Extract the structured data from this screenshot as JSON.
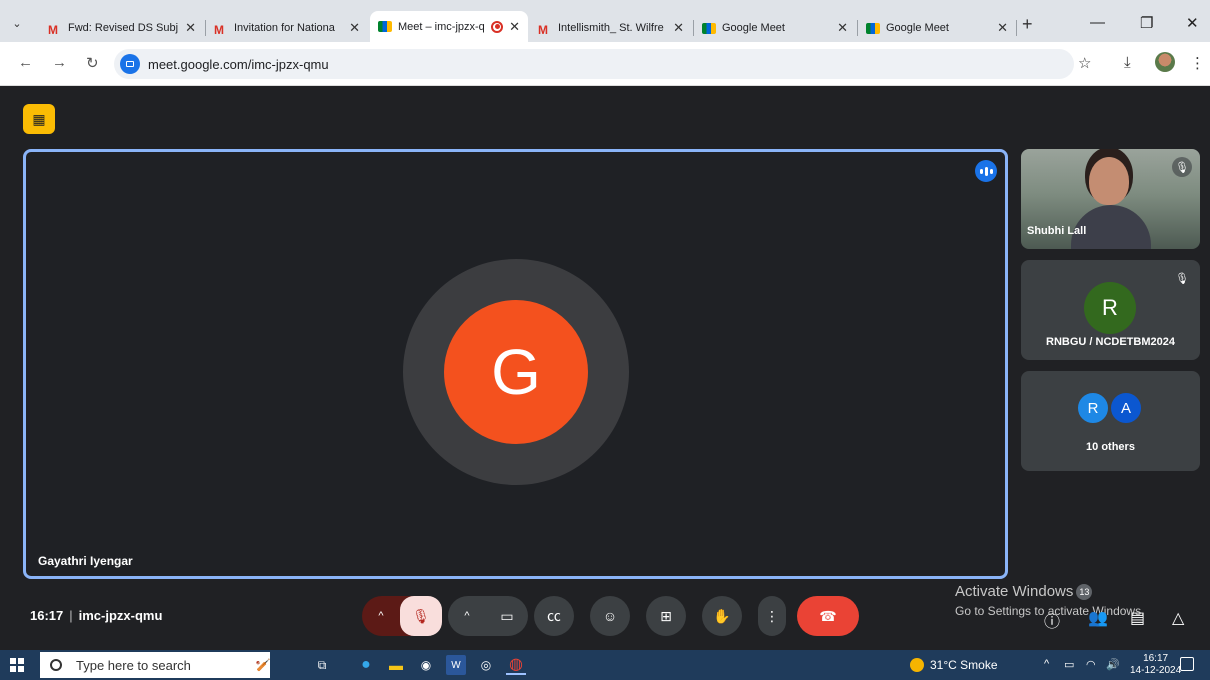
{
  "browser": {
    "tabs": [
      {
        "icon": "gmail-icon",
        "title": "Fwd: Revised DS Subj",
        "active": false
      },
      {
        "icon": "gmail-icon",
        "title": "Invitation for Nationa",
        "active": false
      },
      {
        "icon": "meet-icon",
        "title": "Meet – imc-jpzx-q",
        "active": true,
        "recording": true
      },
      {
        "icon": "gmail-icon",
        "title": "Intellismith_ St. Wilfre",
        "active": false
      },
      {
        "icon": "meet-icon",
        "title": "Google Meet",
        "active": false
      },
      {
        "icon": "meet-icon",
        "title": "Google Meet",
        "active": false
      }
    ],
    "gmail_glyph": "M",
    "close_glyph": "✕",
    "new_tab_glyph": "+",
    "url": "meet.google.com/imc-jpzx-qmu"
  },
  "meet": {
    "main_participant": {
      "name": "Gayathri Iyengar",
      "initial": "G",
      "color": "#f4511e"
    },
    "side_participants": [
      {
        "name": "Shubhi Lall",
        "has_video": true,
        "muted": true
      },
      {
        "name": "RNBGU / NCDETBM2024",
        "initial": "R",
        "color": "#33691e",
        "muted": true
      },
      {
        "name": "10 others",
        "initials": [
          "R",
          "A"
        ],
        "colors": [
          "#1e88e5",
          "#0b57d0"
        ]
      }
    ],
    "clock": "16:17",
    "meeting_code": "imc-jpzx-qmu",
    "accent": "#8ab4f8",
    "end_call_color": "#ea4335"
  },
  "windows_watermark": {
    "title": "Activate Windows",
    "subtitle": "Go to Settings to activate Windows.",
    "notification_count": "13"
  },
  "taskbar": {
    "search_placeholder": "Type here to search",
    "weather": "31°C  Smoke",
    "time": "16:17",
    "date": "14-12-2024"
  }
}
